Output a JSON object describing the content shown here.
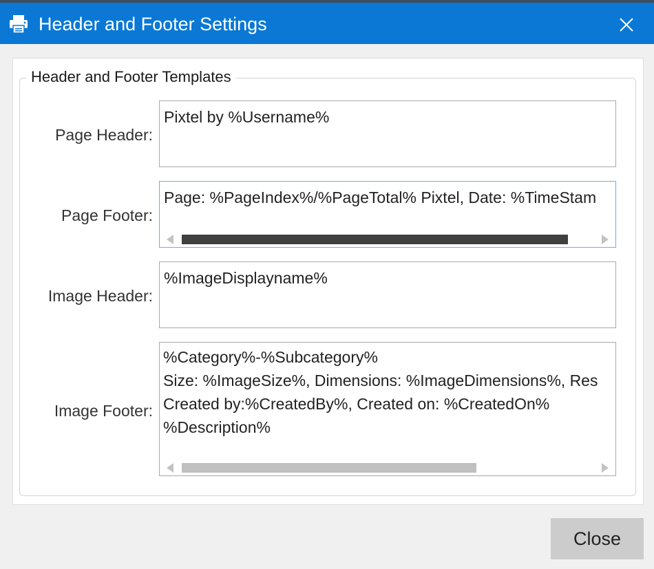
{
  "window": {
    "title": "Header and Footer Settings",
    "title_icon": "printer-icon",
    "close_icon": "close-icon",
    "accent": "#0a78d4"
  },
  "group": {
    "legend": "Header and Footer Templates"
  },
  "fields": {
    "page_header": {
      "label": "Page Header:",
      "value": "Pixtel by %Username%"
    },
    "page_footer": {
      "label": "Page Footer:",
      "value": "Page: %PageIndex%/%PageTotal% Pixtel, Date: %TimeStam"
    },
    "image_header": {
      "label": "Image Header:",
      "value": "%ImageDisplayname%"
    },
    "image_footer": {
      "label": "Image Footer:",
      "value": "%Category%-%Subcategory%\nSize: %ImageSize%, Dimensions: %ImageDimensions%, Res\nCreated by:%CreatedBy%, Created on: %CreatedOn%\n%Description%"
    }
  },
  "buttons": {
    "close_label": "Close"
  }
}
